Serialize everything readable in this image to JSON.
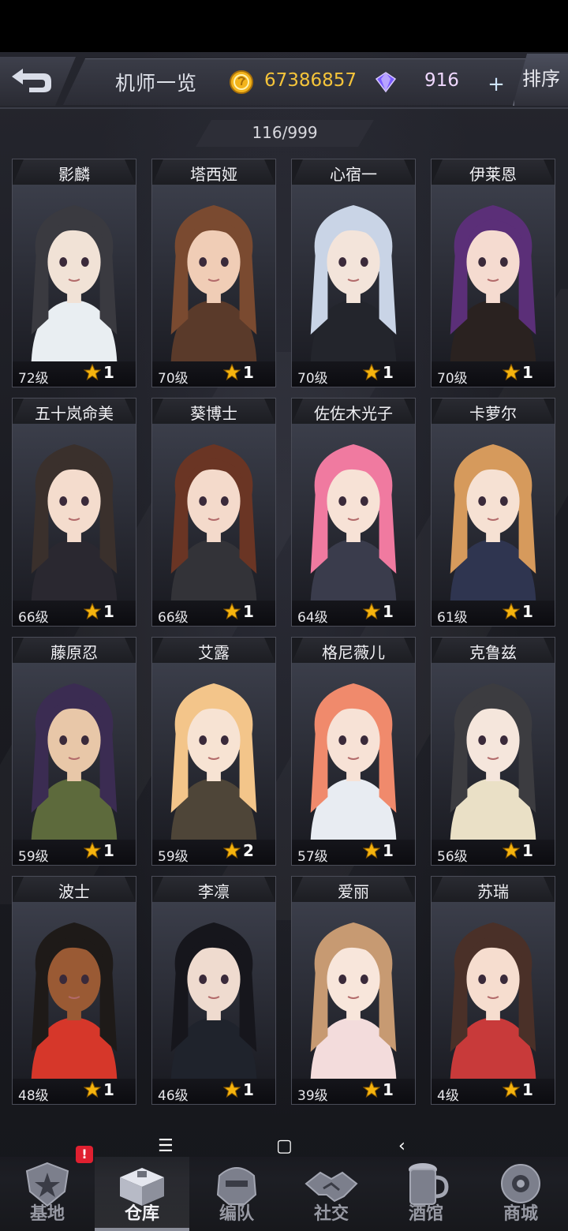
{
  "header": {
    "title": "机师一览",
    "gold": "67386857",
    "gems": "916",
    "plus_label": "+",
    "sort_label": "排序"
  },
  "roster_count": "116/999",
  "cards": [
    {
      "name": "影麟",
      "level": "72级",
      "stars": "1",
      "hair": "#3a3a40",
      "skin": "#f1e2d6",
      "outfit": "#e9eef2"
    },
    {
      "name": "塔西娅",
      "level": "70级",
      "stars": "1",
      "hair": "#7a4a30",
      "skin": "#f0cdb6",
      "outfit": "#5a3a2a"
    },
    {
      "name": "心宿一",
      "level": "70级",
      "stars": "1",
      "hair": "#c9d4e6",
      "skin": "#f3e4da",
      "outfit": "#23252c"
    },
    {
      "name": "伊莱恩",
      "level": "70级",
      "stars": "1",
      "hair": "#5b2f78",
      "skin": "#f5dbd0",
      "outfit": "#2a2220"
    },
    {
      "name": "五十岚命美",
      "level": "66级",
      "stars": "1",
      "hair": "#3a302c",
      "skin": "#f4dccd",
      "outfit": "#2a2830"
    },
    {
      "name": "葵博士",
      "level": "66级",
      "stars": "1",
      "hair": "#6a3524",
      "skin": "#f4dacb",
      "outfit": "#333338"
    },
    {
      "name": "佐佐木光子",
      "level": "64级",
      "stars": "1",
      "hair": "#f07aa0",
      "skin": "#f7e2d6",
      "outfit": "#3a3c4c"
    },
    {
      "name": "卡萝尔",
      "level": "61级",
      "stars": "1",
      "hair": "#d69a5c",
      "skin": "#f6e1d3",
      "outfit": "#2f3550"
    },
    {
      "name": "藤原忍",
      "level": "59级",
      "stars": "1",
      "hair": "#3b2c52",
      "skin": "#e8c7a8",
      "outfit": "#5d6a3c"
    },
    {
      "name": "艾露",
      "level": "59级",
      "stars": "2",
      "hair": "#f3c58a",
      "skin": "#f7e3d3",
      "outfit": "#4e4538"
    },
    {
      "name": "格尼薇儿",
      "level": "57级",
      "stars": "1",
      "hair": "#f08a6c",
      "skin": "#f7e2d6",
      "outfit": "#e8ecf2"
    },
    {
      "name": "克鲁兹",
      "level": "56级",
      "stars": "1",
      "hair": "#3c3c40",
      "skin": "#f5e6dc",
      "outfit": "#eae0c6"
    },
    {
      "name": "波士",
      "level": "48级",
      "stars": "1",
      "hair": "#1e1a18",
      "skin": "#9a5a34",
      "outfit": "#d6372a"
    },
    {
      "name": "李凛",
      "level": "46级",
      "stars": "1",
      "hair": "#16161c",
      "skin": "#efdbcf",
      "outfit": "#1f232c"
    },
    {
      "name": "爱丽",
      "level": "39级",
      "stars": "1",
      "hair": "#c79a72",
      "skin": "#f8e6db",
      "outfit": "#f3dcdc"
    },
    {
      "name": "苏瑞",
      "level": "4级",
      "stars": "1",
      "hair": "#4a3028",
      "skin": "#f6ddcf",
      "outfit": "#c83a3a"
    }
  ],
  "nav": {
    "items": [
      {
        "label": "基地",
        "badge": "!"
      },
      {
        "label": "仓库"
      },
      {
        "label": "编队"
      },
      {
        "label": "社交"
      },
      {
        "label": "酒馆"
      },
      {
        "label": "商城"
      }
    ]
  },
  "softkeys": {
    "menu": "☰",
    "home": "▢",
    "back": "‹"
  },
  "colors": {
    "gold": "#f5c43a",
    "star": "#f6b40e",
    "alert": "#e02030"
  }
}
